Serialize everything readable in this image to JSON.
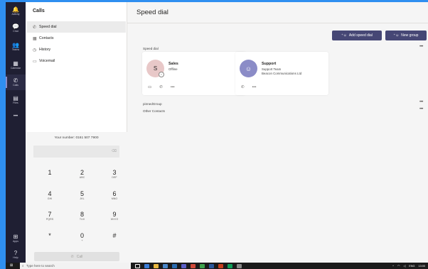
{
  "colors": {
    "desktop": "#2f8ff0",
    "appbar": "#1f1f33",
    "accent": "#464775",
    "sales_avatar": "#e8c8c8",
    "support_avatar": "#8b8cc7"
  },
  "appbar": {
    "items": [
      {
        "icon": "bell-icon",
        "glyph": "🔔",
        "label": "Activity"
      },
      {
        "icon": "chat-icon",
        "glyph": "💬",
        "label": "Chat"
      },
      {
        "icon": "teams-icon",
        "glyph": "👥",
        "label": "Teams"
      },
      {
        "icon": "calendar-icon",
        "glyph": "▦",
        "label": "Calendar"
      },
      {
        "icon": "phone-icon",
        "glyph": "✆",
        "label": "Calls"
      },
      {
        "icon": "files-icon",
        "glyph": "▤",
        "label": "Files"
      },
      {
        "icon": "more-icon",
        "glyph": "•••",
        "label": ""
      }
    ],
    "bottom": [
      {
        "icon": "apps-icon",
        "glyph": "⊞",
        "label": "Apps"
      },
      {
        "icon": "help-icon",
        "glyph": "?",
        "label": "Help"
      }
    ]
  },
  "calls": {
    "title": "Calls",
    "nav": [
      {
        "icon": "✆",
        "label": "Speed dial"
      },
      {
        "icon": "▦",
        "label": "Contacts"
      },
      {
        "icon": "◷",
        "label": "History"
      },
      {
        "icon": "▭",
        "label": "Voicemail"
      }
    ],
    "your_number": "Your number: 0161 507 7900",
    "keypad": [
      {
        "d": "1",
        "s": ""
      },
      {
        "d": "2",
        "s": "ABC"
      },
      {
        "d": "3",
        "s": "DEF"
      },
      {
        "d": "4",
        "s": "GHI"
      },
      {
        "d": "5",
        "s": "JKL"
      },
      {
        "d": "6",
        "s": "MNO"
      },
      {
        "d": "7",
        "s": "PQRS"
      },
      {
        "d": "8",
        "s": "TUV"
      },
      {
        "d": "9",
        "s": "WXYZ"
      },
      {
        "d": "*",
        "s": ""
      },
      {
        "d": "0",
        "s": "+"
      },
      {
        "d": "#",
        "s": ""
      }
    ],
    "call_label": "Call"
  },
  "main": {
    "title": "Speed dial",
    "add_speed_dial": "Add speed dial",
    "new_group": "New group",
    "section_speed_dial": "Speed dial",
    "cards": [
      {
        "initial": "S",
        "name": "Sales",
        "lines": [
          "Offline"
        ]
      },
      {
        "initial": "",
        "name": "Support",
        "lines": [
          "Support Team",
          "Beacon Communications Ltd"
        ]
      }
    ],
    "groups": [
      "pinnedGroup",
      "Other Contacts"
    ]
  },
  "taskbar": {
    "search_placeholder": "Type here to search",
    "clock": "13:00",
    "lang": "ENG"
  }
}
